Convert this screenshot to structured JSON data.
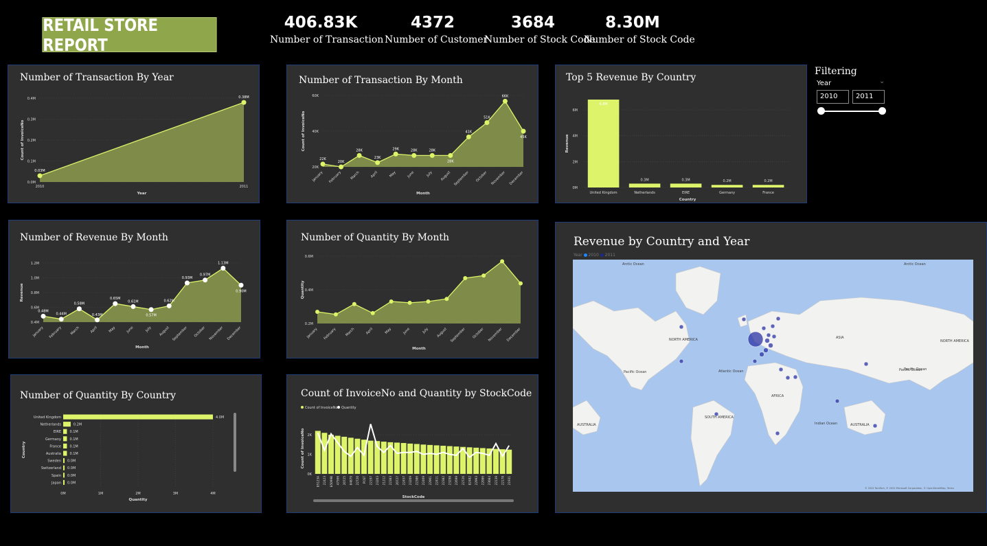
{
  "header": {
    "title": "RETAIL STORE REPORT",
    "kpis": [
      {
        "value": "406.83K",
        "label": "Number of Transaction"
      },
      {
        "value": "4372",
        "label": "Number of Customer"
      },
      {
        "value": "3684",
        "label": "Number of Stock Code"
      },
      {
        "value": "8.30M",
        "label": "Number of Stock Code"
      }
    ]
  },
  "filter": {
    "title": "Filtering",
    "label": "Year",
    "from": "2010",
    "to": "2011",
    "range_fraction": [
      0,
      1
    ]
  },
  "colors": {
    "accent": "#ddf46a",
    "area": "#8d9b4e",
    "panel": "#2f2f2f",
    "border": "#1f3b7a",
    "map_water": "#a9c7ee",
    "map_land": "#f2f2f0",
    "map_dot": "#2b34a6"
  },
  "map": {
    "title": "Revenue by Country and Year",
    "legend": {
      "label": "Year",
      "items": [
        "2010",
        "2011"
      ]
    },
    "labels": [
      "Arctic Ocean",
      "Arctic Ocean",
      "NORTH AMERICA",
      "ASIA",
      "NORTH AMERICA",
      "Pacific Ocean",
      "Atlantic Ocean",
      "Pacific Ocean",
      "Pacific Ocean",
      "AFRICA",
      "SOUTH AMERICA",
      "Indian Ocean",
      "AUSTRALIA",
      "AUSTRALIA"
    ],
    "copyright": "© 2022 TomTom, © 2022 Microsoft Corporation, © OpenStreetMap, Terms"
  },
  "chart_data": [
    {
      "type": "area",
      "title": "Number of Transaction By Year",
      "xlabel": "Year",
      "ylabel": "Count of InvoiceNo",
      "categories": [
        "2010",
        "2011"
      ],
      "values": [
        0.03,
        0.38
      ],
      "data_labels": [
        "0.03M",
        "0.38M"
      ],
      "yticks": [
        "0.0M",
        "0.1M",
        "0.2M",
        "0.3M",
        "0.4M"
      ],
      "ylim": [
        0,
        0.4
      ]
    },
    {
      "type": "area",
      "title": "Number of Transaction By Month",
      "xlabel": "Month",
      "ylabel": "Count of InvoiceNo",
      "categories": [
        "January",
        "February",
        "March",
        "April",
        "May",
        "June",
        "July",
        "August",
        "September",
        "October",
        "November",
        "December"
      ],
      "values": [
        22,
        20,
        28,
        23,
        29,
        28,
        28,
        28,
        41,
        51,
        66,
        45
      ],
      "data_labels": [
        "22K",
        "20K",
        "28K",
        "23K",
        "29K",
        "28K",
        "28K",
        "28K",
        "41K",
        "51K",
        "66K",
        "45K"
      ],
      "yticks": [
        "20K",
        "40K",
        "60K"
      ],
      "ylim": [
        20,
        70
      ]
    },
    {
      "type": "bar",
      "title": "Top 5 Revenue By Country",
      "xlabel": "Country",
      "ylabel": "Revenue",
      "categories": [
        "United Kingdom",
        "Netherlands",
        "EIRE",
        "Germany",
        "France"
      ],
      "values": [
        6.8,
        0.3,
        0.3,
        0.2,
        0.2
      ],
      "data_labels": [
        "6.8M",
        "0.3M",
        "0.3M",
        "0.2M",
        "0.2M"
      ],
      "yticks": [
        "0M",
        "2M",
        "4M",
        "6M"
      ],
      "ylim": [
        0,
        6.8
      ]
    },
    {
      "type": "area",
      "title": "Number of Revenue By Month",
      "xlabel": "Month",
      "ylabel": "Revenue",
      "categories": [
        "January",
        "February",
        "March",
        "April",
        "May",
        "June",
        "July",
        "August",
        "September",
        "October",
        "November",
        "December"
      ],
      "values": [
        0.48,
        0.44,
        0.58,
        0.43,
        0.65,
        0.61,
        0.57,
        0.62,
        0.93,
        0.97,
        1.13,
        0.9
      ],
      "data_labels": [
        "0.48M",
        "0.44M",
        "0.58M",
        "0.43M",
        "0.65M",
        "0.61M",
        "0.57M",
        "0.62M",
        "0.93M",
        "0.97M",
        "1.13M",
        "0.90M"
      ],
      "yticks": [
        "0.4M",
        "0.6M",
        "0.8M",
        "1.0M",
        "1.2M"
      ],
      "ylim": [
        0.4,
        1.2
      ]
    },
    {
      "type": "area",
      "title": "Number of Quantity By Month",
      "xlabel": "Month",
      "ylabel": "Quantity",
      "categories": [
        "January",
        "February",
        "March",
        "April",
        "May",
        "June",
        "July",
        "August",
        "September",
        "October",
        "November",
        "December"
      ],
      "values": [
        0.29,
        0.27,
        0.35,
        0.28,
        0.37,
        0.36,
        0.37,
        0.39,
        0.55,
        0.57,
        0.68,
        0.51
      ],
      "yticks": [
        "0.2M",
        "0.4M",
        "0.6M"
      ],
      "ylim": [
        0.2,
        0.72
      ]
    },
    {
      "type": "bar",
      "orientation": "horizontal",
      "title": "Number of Quantity By Country",
      "xlabel": "Quantity",
      "ylabel": "Country",
      "categories": [
        "United Kingdom",
        "Netherlands",
        "EIRE",
        "Germany",
        "France",
        "Australia",
        "Sweden",
        "Switzerland",
        "Spain",
        "Japan"
      ],
      "values": [
        4.0,
        0.2,
        0.1,
        0.1,
        0.1,
        0.1,
        0.0,
        0.0,
        0.0,
        0.0
      ],
      "data_labels": [
        "4.0M",
        "0.2M",
        "0.1M",
        "0.1M",
        "0.1M",
        "0.1M",
        "0.0M",
        "0.0M",
        "0.0M",
        "0.0M"
      ],
      "xticks": [
        "0M",
        "1M",
        "2M",
        "3M",
        "4M"
      ],
      "xlim": [
        0,
        4
      ]
    },
    {
      "type": "bar",
      "title": "Count of InvoiceNo and Quantity by StockCode",
      "xlabel": "StockCode",
      "ylabel": "Count of InvoiceNo",
      "legend": [
        "Count of InvoiceNo",
        "Quantity"
      ],
      "categories": [
        "85123A",
        "22423",
        "85099B",
        "47566",
        "20725",
        "84879",
        "22720",
        "POST",
        "22197",
        "23203",
        "21212",
        "22383",
        "20727",
        "22457",
        "23209",
        "22386",
        "22469",
        "22961",
        "22411",
        "22382",
        "23298",
        "22699",
        "22726",
        "82482",
        "22993",
        "22086",
        "23084",
        "22139",
        "22178",
        "21931"
      ],
      "series": [
        {
          "name": "Count of InvoiceNo",
          "values": [
            2.2,
            2.1,
            2.0,
            1.95,
            1.9,
            1.85,
            1.8,
            1.75,
            1.7,
            1.68,
            1.65,
            1.62,
            1.6,
            1.58,
            1.55,
            1.53,
            1.5,
            1.48,
            1.46,
            1.44,
            1.42,
            1.4,
            1.38,
            1.36,
            1.34,
            1.32,
            1.3,
            1.28,
            1.26,
            1.24
          ]
        },
        {
          "name": "Quantity",
          "values": [
            2.1,
            1.2,
            2.05,
            1.6,
            1.15,
            0.9,
            1.35,
            0.95,
            2.55,
            1.4,
            1.1,
            1.45,
            1.05,
            1.1,
            1.1,
            1.15,
            1.0,
            1.05,
            1.0,
            1.1,
            1.0,
            0.95,
            1.3,
            0.85,
            1.1,
            1.05,
            0.95,
            1.55,
            0.9,
            1.45
          ]
        }
      ],
      "yticks": [
        "0K",
        "1K",
        "2K"
      ],
      "ylim": [
        0,
        2.6
      ]
    }
  ]
}
